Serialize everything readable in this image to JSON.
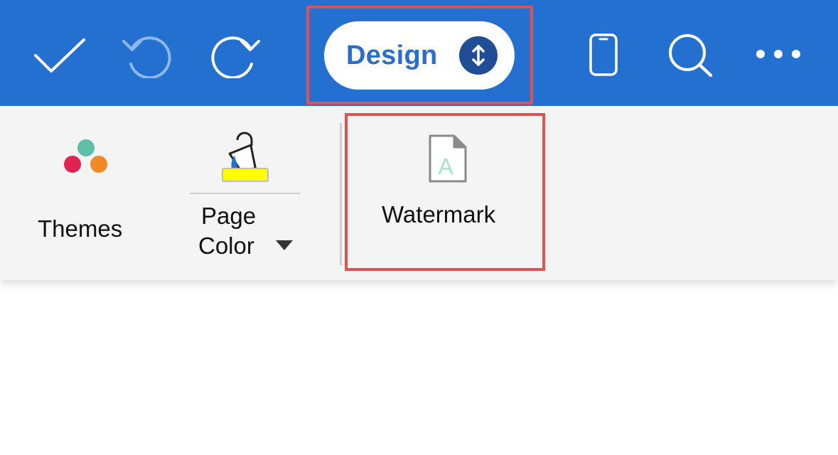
{
  "topbar": {
    "tab_label": "Design",
    "tab_selector_icon": "up-down-arrows-icon",
    "accent_color": "#2370d1",
    "icons": [
      "checkmark-icon",
      "undo-icon",
      "redo-icon",
      "phone-icon",
      "search-icon",
      "more-icon"
    ]
  },
  "ribbon": {
    "themes": {
      "label": "Themes",
      "icon": "themes-dots-icon"
    },
    "page_color": {
      "label_line1": "Page",
      "label_line2": "Color",
      "icon": "paint-bucket-icon",
      "swatch_color": "#ffff00"
    },
    "watermark": {
      "label": "Watermark",
      "icon": "watermark-document-icon"
    }
  },
  "highlight_color": "#e05252"
}
